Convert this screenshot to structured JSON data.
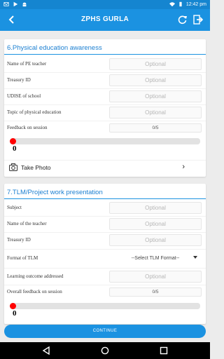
{
  "status_bar": {
    "left_icons": [
      "mail-icon",
      "play-icon",
      "android-icon"
    ],
    "right_icons": [
      "wifi-icon",
      "battery-icon"
    ],
    "time": "12:42 pm"
  },
  "app_bar": {
    "title": "ZPHS GURLA",
    "back_icon": "chevron-left-icon",
    "actions": [
      "refresh-icon",
      "logout-icon"
    ]
  },
  "sections": [
    {
      "title": "6.Physical education awareness",
      "fields": [
        {
          "label": "Name of PE teacher",
          "placeholder": "Optional"
        },
        {
          "label": "Treasury ID",
          "placeholder": "Optional"
        },
        {
          "label": "UDISE of school",
          "placeholder": "Optional"
        },
        {
          "label": "Topic of physical education",
          "placeholder": "Optional"
        }
      ],
      "feedback": {
        "label": "Feedback on session",
        "score": "0/5",
        "value": 0
      },
      "take_photo": "Take Photo"
    },
    {
      "title": "7.TLM/Project work presentation",
      "fields": [
        {
          "label": "Subject",
          "placeholder": "Optional"
        },
        {
          "label": "Name of the teacher",
          "placeholder": "Optional"
        },
        {
          "label": "Treasury ID",
          "placeholder": "Optional"
        }
      ],
      "format": {
        "label": "Format of TLM",
        "selected": "--Select TLM Format--"
      },
      "outcome": {
        "label": "Learning outcome addressed",
        "placeholder": "Optional"
      },
      "feedback": {
        "label": "Overall feedback on session",
        "score": "0/5",
        "value": 0
      }
    }
  ],
  "continue_label": "CONTINUE",
  "nav_bar": [
    "back-triangle-icon",
    "home-circle-icon",
    "recents-square-icon"
  ],
  "colors": {
    "primary": "#1b92e1",
    "status_bar": "#1585d0",
    "slider_thumb": "#ff0000"
  }
}
